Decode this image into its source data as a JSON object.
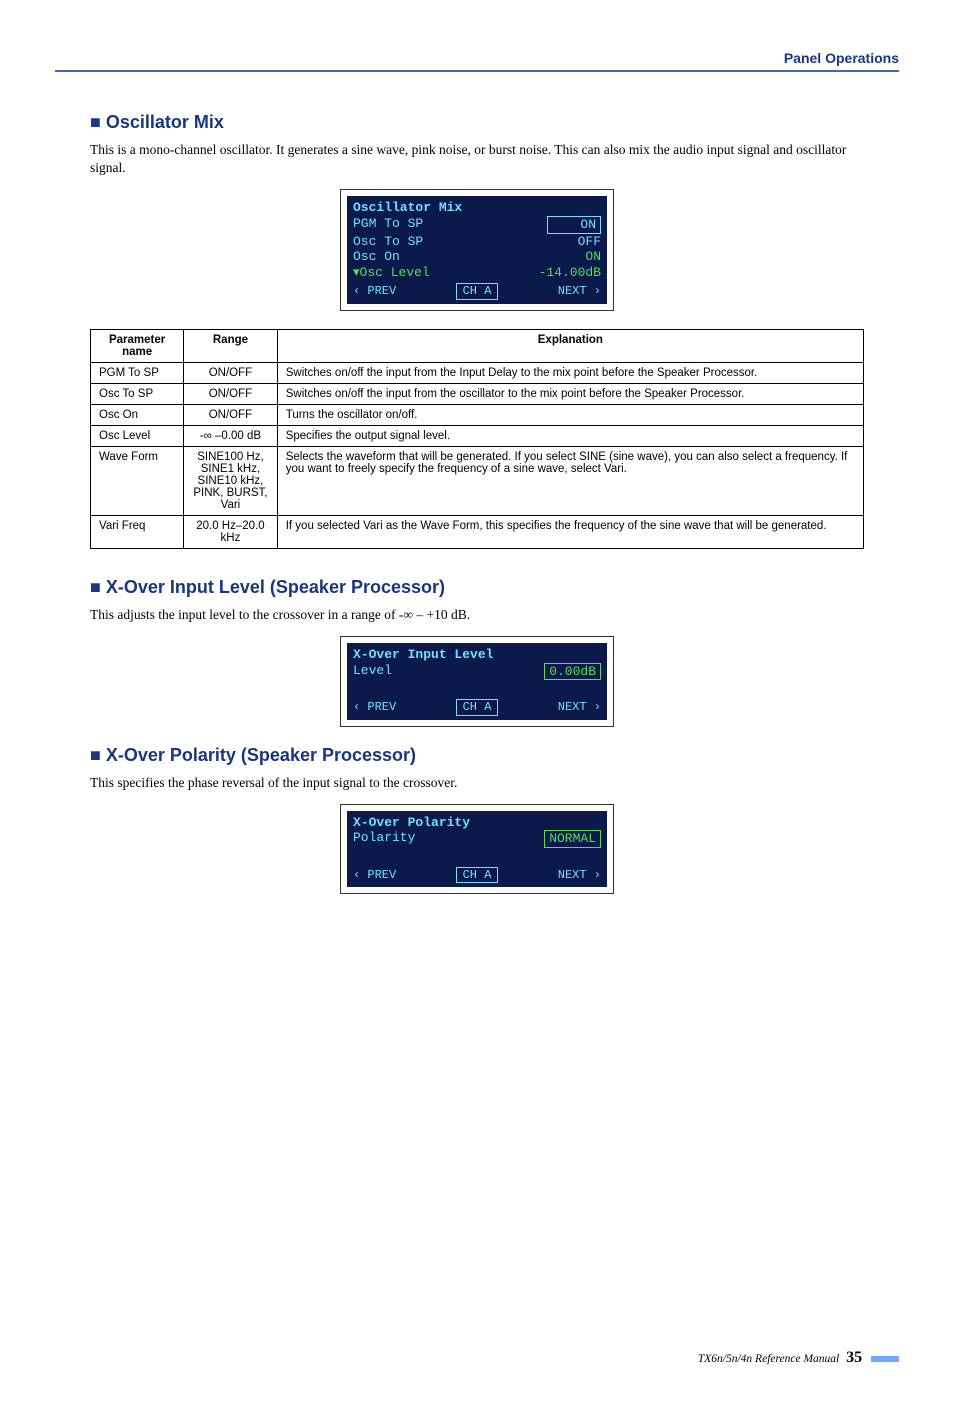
{
  "header": {
    "section_title": "Panel Operations"
  },
  "osc": {
    "heading": "■ Oscillator Mix",
    "body": "This is a mono-channel oscillator. It generates a sine wave, pink noise, or burst noise. This can also mix the audio input signal and oscillator signal.",
    "lcd": {
      "title": "Oscillator Mix",
      "rows": [
        {
          "label": "PGM To SP",
          "value": "ON",
          "boxed": true
        },
        {
          "label": "Osc To SP",
          "value": "OFF",
          "boxed": false
        },
        {
          "label": "Osc On",
          "value": "ON",
          "boxed": false,
          "green": true
        },
        {
          "label": "▾Osc Level",
          "value": "-14.00dB",
          "boxed": false,
          "green": true
        }
      ],
      "nav": {
        "prev": "PREV",
        "ch": "CH A",
        "next": "NEXT"
      }
    },
    "table": {
      "headers": [
        "Parameter name",
        "Range",
        "Explanation"
      ],
      "rows": [
        {
          "name": "PGM To SP",
          "range": "ON/OFF",
          "explain": "Switches on/off the input from the Input Delay to the mix point before the Speaker Processor."
        },
        {
          "name": "Osc To SP",
          "range": "ON/OFF",
          "explain": "Switches on/off the input from the oscillator to the mix point before the Speaker Processor."
        },
        {
          "name": "Osc On",
          "range": "ON/OFF",
          "explain": "Turns the oscillator on/off."
        },
        {
          "name": "Osc Level",
          "range": "-∞ –0.00 dB",
          "explain": "Specifies the output signal level."
        },
        {
          "name": "Wave Form",
          "range": "SINE100 Hz,\nSINE1 kHz,\nSINE10 kHz,\nPINK, BURST, Vari",
          "explain": "Selects the waveform that will be generated. If you select SINE (sine wave), you can also select a frequency. If you want to freely specify the frequency of a sine wave, select Vari."
        },
        {
          "name": "Vari Freq",
          "range": "20.0 Hz–20.0 kHz",
          "explain": "If you selected Vari as the Wave Form, this specifies the frequency of the sine wave that will be generated."
        }
      ]
    }
  },
  "xil": {
    "heading": "■ X-Over Input Level (Speaker Processor)",
    "body": "This adjusts the input level to the crossover in a range of -∞ – +10 dB.",
    "lcd": {
      "title": "X-Over Input Level",
      "row": {
        "label": "Level",
        "value": "0.00dB"
      },
      "nav": {
        "prev": "PREV",
        "ch": "CH A",
        "next": "NEXT"
      }
    }
  },
  "xpol": {
    "heading": "■ X-Over Polarity (Speaker Processor)",
    "body": "This specifies the phase reversal of the input signal to the crossover.",
    "lcd": {
      "title": "X-Over Polarity",
      "row": {
        "label": "Polarity",
        "value": "NORMAL"
      },
      "nav": {
        "prev": "PREV",
        "ch": "CH A",
        "next": "NEXT"
      }
    }
  },
  "footer": {
    "manual": "TX6n/5n/4n  Reference Manual",
    "page": "35"
  }
}
